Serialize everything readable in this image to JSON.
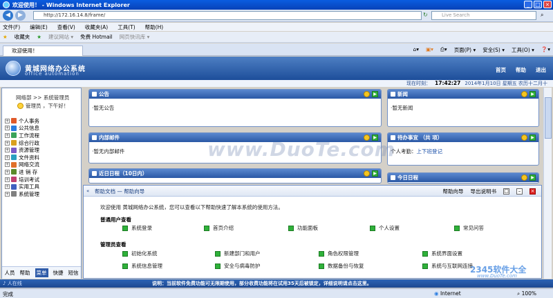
{
  "browser": {
    "title": "欢迎使用！ - Windows Internet Explorer",
    "address": "http://172.16.14.8/frame/",
    "search_placeholder": "Live Search",
    "menu": [
      "文件(F)",
      "编辑(E)",
      "查看(V)",
      "收藏夹(A)",
      "工具(T)",
      "帮助(H)"
    ],
    "favorites": [
      "收藏夹",
      "建议网站 ▾",
      "免费 Hotmail",
      "网页快讯库 ▾"
    ],
    "tab_label": "欢迎使用！",
    "tools": [
      "页面(P) ▾",
      "安全(S) ▾",
      "工具(O) ▾",
      "❓▾"
    ]
  },
  "app": {
    "title": "黄城网络办公系统",
    "subtitle": "office automation",
    "nav": [
      "首页",
      "帮助",
      "退出"
    ],
    "clock_label": "现在时刻：",
    "clock_time": "17:42:27",
    "clock_date": "2014年1月10日 星期五 农历十二月十"
  },
  "sidebar": {
    "dept": "网络部 >> 系统管理员",
    "user": "管理员 ，下午好！",
    "items": [
      {
        "label": "个人事务",
        "color": "#e05a2a"
      },
      {
        "label": "公共信息",
        "color": "#2a7de0"
      },
      {
        "label": "工作流程",
        "color": "#3aa35a"
      },
      {
        "label": "综合行政",
        "color": "#d9a020"
      },
      {
        "label": "资源管理",
        "color": "#7a5ac8"
      },
      {
        "label": "文件资料",
        "color": "#2a9fc0"
      },
      {
        "label": "网络交流",
        "color": "#e0702a"
      },
      {
        "label": "进 销 存",
        "color": "#5a8a2a"
      },
      {
        "label": "培训考试",
        "color": "#c04070"
      },
      {
        "label": "实用工具",
        "color": "#4060c0"
      },
      {
        "label": "系统管理",
        "color": "#808080"
      }
    ],
    "tabs": [
      "人员",
      "帮助",
      "菜单",
      "快捷",
      "短信"
    ],
    "active_tab": 2
  },
  "panels": {
    "notice": {
      "title": "公告",
      "body": "·暂无公告"
    },
    "news": {
      "title": "新闻",
      "body": "·暂无新闻"
    },
    "mail": {
      "title": "内部邮件",
      "body": "·暂无内部邮件"
    },
    "tasks": {
      "title": "待办事宜 （共 项）",
      "body_label": "个人考勤：",
      "body_link": "上下班登记"
    },
    "schedule": {
      "title": "近日日程（10日内）"
    },
    "today": {
      "title": "今日日程"
    }
  },
  "help": {
    "title": "帮助文档 — 帮助向导",
    "actions": [
      "帮助向导",
      "导出说明书"
    ],
    "welcome": "欢迎使用 黄城网络办公系统，您可以查看以下帮助快速了解本系统的使用方法。",
    "user_section": "普通用户查看",
    "user_links": [
      "系统登录",
      "首页介绍",
      "功能面板",
      "个人设置",
      "常见问答"
    ],
    "admin_section": "管理员查看",
    "admin_links": [
      "初始化系统",
      "新建部门和用户",
      "角色权限管理",
      "系统界面设置",
      "系统信息管理",
      "安全与病毒防护",
      "数据备份与恢复",
      "系统与互联网连接"
    ]
  },
  "notice_bar": {
    "left": "♪ 人在线",
    "text": "说明：当前软件免费功能可无限期使用，部分收费功能将在试用35天后被锁定，详细说明请点击这里。"
  },
  "status": {
    "left": "完成",
    "zone": "Internet",
    "zoom": "100%"
  },
  "watermarks": [
    "www.DuoTe.com",
    "2345软件大全",
    "www.DuoTe.com"
  ]
}
